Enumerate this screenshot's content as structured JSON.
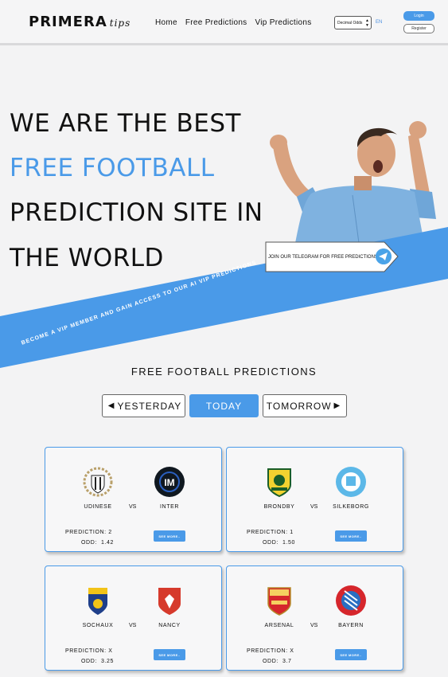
{
  "header": {
    "logo_main": "PRIMERA",
    "logo_sub": "tips",
    "nav": [
      "Home",
      "Free Predictions",
      "Vip Predictions"
    ],
    "odds_select": "Decimal Odds",
    "lang": "EN",
    "login": "Login",
    "register": "Register"
  },
  "hero": {
    "line1": "WE ARE THE BEST",
    "line2": "FREE FOOTBALL",
    "line3": "PREDICTION SITE IN",
    "line4": "THE WORLD",
    "telegram_cta": "JOIN OUR TELEGRAM FOR FREE PREDICTIONS",
    "band_text": "BECOME A VIP MEMBER AND GAIN ACCESS TO OUR AI VIP PREDICTIONS",
    "colors": {
      "accent": "#4a9ae8"
    }
  },
  "predictions": {
    "title": "FREE FOOTBALL PREDICTIONS",
    "days": [
      "YESTERDAY",
      "TODAY",
      "TOMORROW"
    ],
    "active_day": "TODAY",
    "vs_label": "VS",
    "prediction_label": "PREDICTION:",
    "odd_label": "ODD:",
    "see_more": "SEE MORE..",
    "matches": [
      {
        "home": "UDINESE",
        "away": "INTER",
        "prediction": "2",
        "odd": "1.42",
        "home_icon": "udinese-crest-icon",
        "away_icon": "inter-crest-icon"
      },
      {
        "home": "BRONDBY",
        "away": "SILKEBORG",
        "prediction": "1",
        "odd": "1.50",
        "home_icon": "brondby-crest-icon",
        "away_icon": "silkeborg-crest-icon"
      },
      {
        "home": "SOCHAUX",
        "away": "NANCY",
        "prediction": "X",
        "odd": "3.25",
        "home_icon": "sochaux-crest-icon",
        "away_icon": "nancy-crest-icon"
      },
      {
        "home": "ARSENAL",
        "away": "BAYERN",
        "prediction": "X",
        "odd": "3.7",
        "home_icon": "arsenal-crest-icon",
        "away_icon": "bayern-crest-icon"
      }
    ]
  }
}
